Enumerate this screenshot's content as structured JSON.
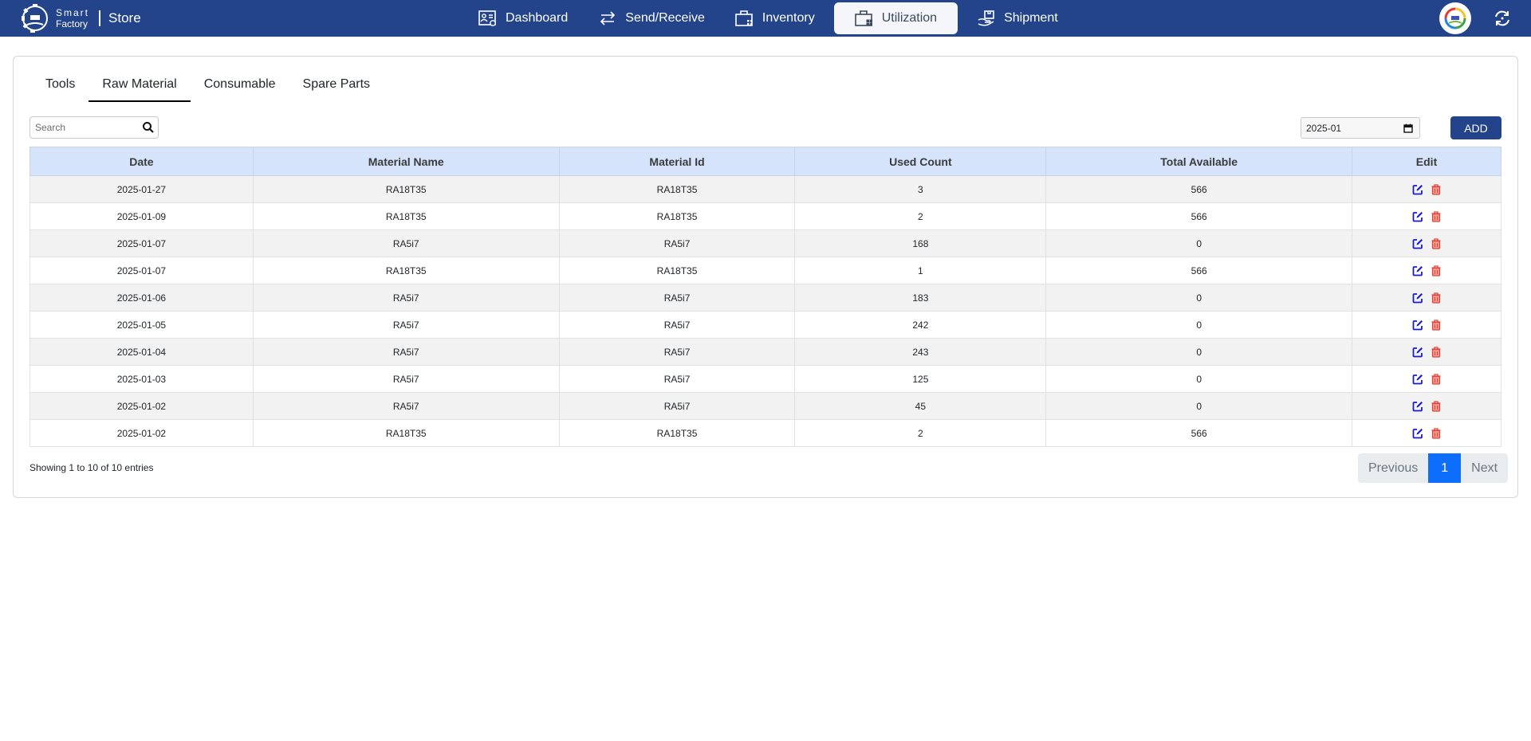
{
  "header": {
    "brand_line1": "Smart",
    "brand_line2": "Factory",
    "module": "Store",
    "nav": [
      {
        "label": "Dashboard",
        "icon": "dashboard-icon",
        "active": false
      },
      {
        "label": "Send/Receive",
        "icon": "arrows-exchange-icon",
        "active": false
      },
      {
        "label": "Inventory",
        "icon": "briefcase-icon",
        "active": false
      },
      {
        "label": "Utilization",
        "icon": "briefcase-icon",
        "active": true
      },
      {
        "label": "Shipment",
        "icon": "hand-box-icon",
        "active": false
      }
    ],
    "colors": {
      "bar": "#23448a",
      "active_tab_bg": "#f4f6fa"
    }
  },
  "tabs": [
    {
      "label": "Tools",
      "active": false
    },
    {
      "label": "Raw Material",
      "active": true
    },
    {
      "label": "Consumable",
      "active": false
    },
    {
      "label": "Spare Parts",
      "active": false
    }
  ],
  "search": {
    "placeholder": "Search",
    "value": ""
  },
  "month_filter": {
    "value": "2025-01"
  },
  "add_button": "ADD",
  "table": {
    "columns": [
      "Date",
      "Material Name",
      "Material Id",
      "Used Count",
      "Total Available",
      "Edit"
    ],
    "rows": [
      {
        "date": "2025-01-27",
        "name": "RA18T35",
        "id": "RA18T35",
        "used": "3",
        "available": "566"
      },
      {
        "date": "2025-01-09",
        "name": "RA18T35",
        "id": "RA18T35",
        "used": "2",
        "available": "566"
      },
      {
        "date": "2025-01-07",
        "name": "RA5i7",
        "id": "RA5i7",
        "used": "168",
        "available": "0"
      },
      {
        "date": "2025-01-07",
        "name": "RA18T35",
        "id": "RA18T35",
        "used": "1",
        "available": "566"
      },
      {
        "date": "2025-01-06",
        "name": "RA5i7",
        "id": "RA5i7",
        "used": "183",
        "available": "0"
      },
      {
        "date": "2025-01-05",
        "name": "RA5i7",
        "id": "RA5i7",
        "used": "242",
        "available": "0"
      },
      {
        "date": "2025-01-04",
        "name": "RA5i7",
        "id": "RA5i7",
        "used": "243",
        "available": "0"
      },
      {
        "date": "2025-01-03",
        "name": "RA5i7",
        "id": "RA5i7",
        "used": "125",
        "available": "0"
      },
      {
        "date": "2025-01-02",
        "name": "RA5i7",
        "id": "RA5i7",
        "used": "45",
        "available": "0"
      },
      {
        "date": "2025-01-02",
        "name": "RA18T35",
        "id": "RA18T35",
        "used": "2",
        "available": "566"
      }
    ],
    "colors": {
      "header_bg": "#d5e3fb",
      "edit_icon": "#1a1ad6",
      "delete_icon": "#e0453a"
    }
  },
  "footer": {
    "showing": "Showing 1 to 10 of 10 entries",
    "previous": "Previous",
    "current_page": "1",
    "next": "Next"
  }
}
